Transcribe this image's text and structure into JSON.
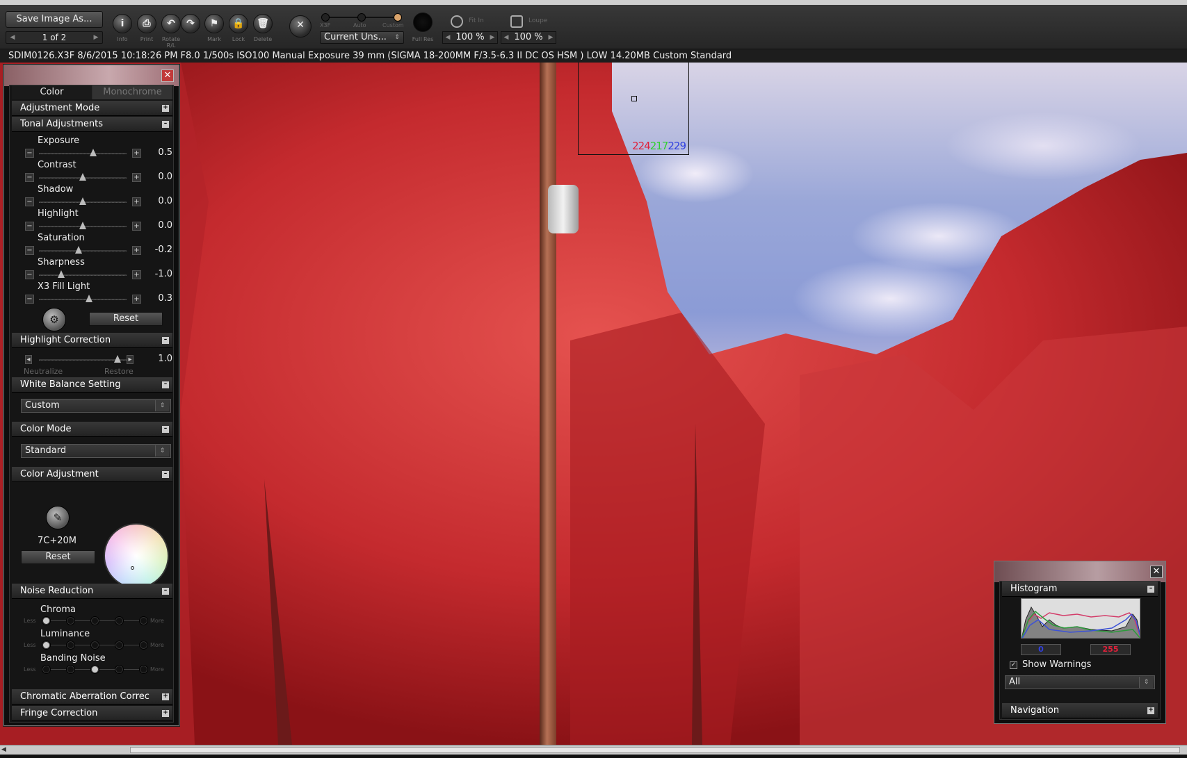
{
  "toolbar": {
    "save_label": "Save Image As...",
    "pager": "1 of 2",
    "tools": [
      {
        "icon": "i",
        "label": "Info"
      },
      {
        "icon": "⎙",
        "label": "Print"
      },
      {
        "icon": "↶",
        "label": "Rotate R/L"
      },
      {
        "icon": "↷",
        "label": ""
      },
      {
        "icon": "⚑",
        "label": "Mark"
      },
      {
        "icon": "🔒",
        "label": "Lock"
      },
      {
        "icon": "🗑",
        "label": "Delete"
      }
    ],
    "modes": [
      "X3F",
      "Auto",
      "Custom"
    ],
    "settings_select": "Current Uns...",
    "full_res": "Full Res",
    "fit_in": "Fit In",
    "loupe": "Loupe",
    "zoom1": "100 %",
    "zoom2": "100 %"
  },
  "infobar": "SDIM0126.X3F 8/6/2015 10:18:26 PM F8.0 1/500s ISO100 Manual Exposure 39 mm (SIGMA 18-200MM F/3.5-6.3 II DC OS HSM ) LOW 14.20MB Custom Standard",
  "loupe": {
    "r": "224",
    "g": "217",
    "b": "229"
  },
  "panel": {
    "tabs": {
      "color": "Color",
      "mono": "Monochrome"
    },
    "sections": {
      "adjustment_mode": "Adjustment Mode",
      "tonal": "Tonal Adjustments",
      "highlight_corr": "Highlight Correction",
      "wb": "White Balance Setting",
      "color_mode": "Color Mode",
      "color_adj": "Color Adjustment",
      "noise": "Noise Reduction",
      "chromatic": "Chromatic Aberration Correc",
      "fringe": "Fringe Correction"
    },
    "sliders": [
      {
        "label": "Exposure",
        "value": "0.5",
        "pos": 0.62
      },
      {
        "label": "Contrast",
        "value": "0.0",
        "pos": 0.5
      },
      {
        "label": "Shadow",
        "value": "0.0",
        "pos": 0.5
      },
      {
        "label": "Highlight",
        "value": "0.0",
        "pos": 0.5
      },
      {
        "label": "Saturation",
        "value": "-0.2",
        "pos": 0.45
      },
      {
        "label": "Sharpness",
        "value": "-1.0",
        "pos": 0.25
      },
      {
        "label": "X3 Fill Light",
        "value": "0.3",
        "pos": 0.57
      }
    ],
    "reset": "Reset",
    "highlight": {
      "value": "1.0",
      "neutralize": "Neutralize",
      "restore": "Restore",
      "pos": 0.9
    },
    "wb_value": "Custom",
    "color_mode_value": "Standard",
    "color_adj_value": "7C+20M",
    "color_reset": "Reset",
    "noise": [
      {
        "label": "Chroma",
        "selected": 0
      },
      {
        "label": "Luminance",
        "selected": 0
      },
      {
        "label": "Banding Noise",
        "selected": 2
      }
    ],
    "less": "Less",
    "more": "More"
  },
  "histogram": {
    "title": "Histogram",
    "low": "0",
    "high": "255",
    "show_warnings": "Show Warnings",
    "channel": "All",
    "navigation": "Navigation"
  },
  "colors": {
    "red_text": "#e0203a",
    "green_text": "#2fd02f",
    "blue_text": "#3040e0"
  }
}
